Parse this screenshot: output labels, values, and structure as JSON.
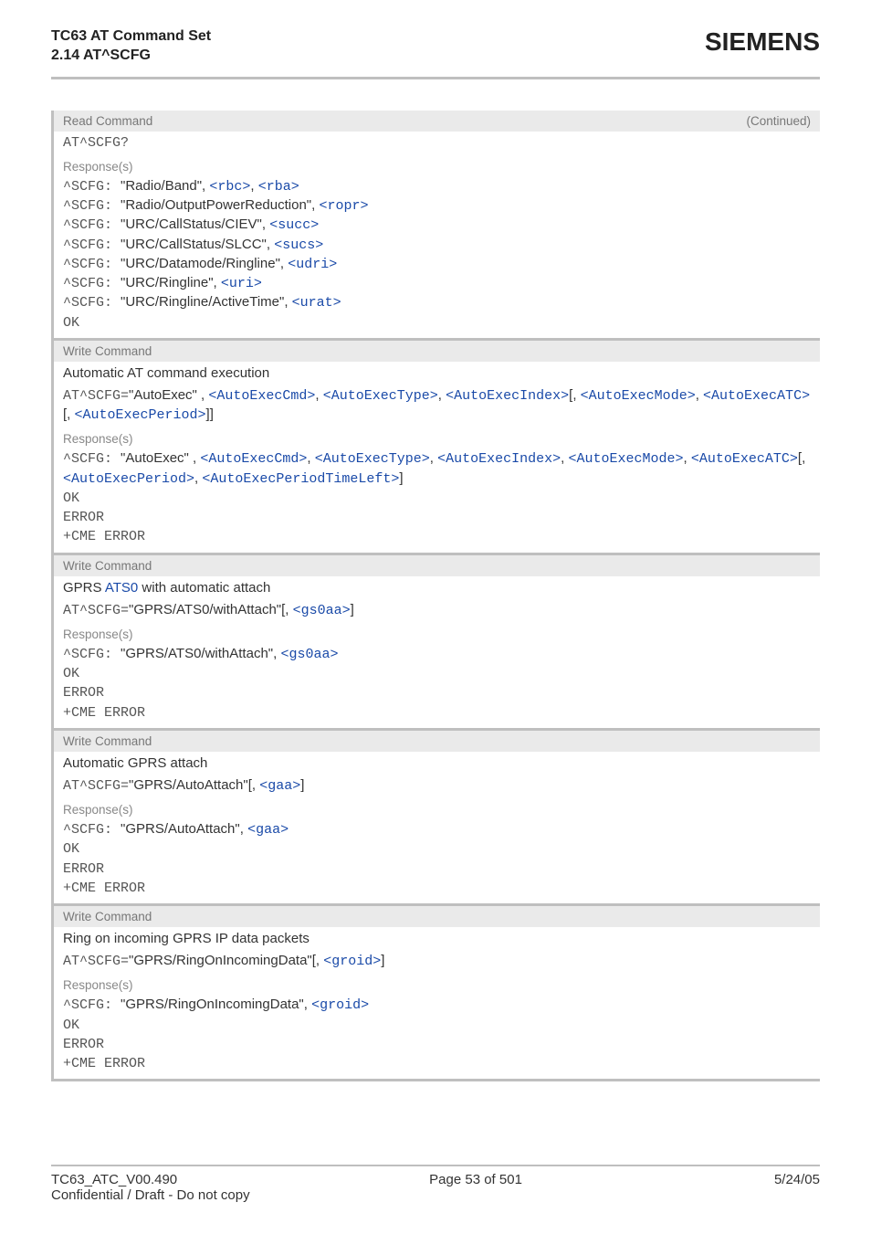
{
  "header": {
    "title_line1": "TC63 AT Command Set",
    "title_line2": "2.14 AT^SCFG",
    "brand": "SIEMENS"
  },
  "sections": [
    {
      "head_left": "Read Command",
      "head_right": "(Continued)",
      "cmd_segments": [
        {
          "cls": "mono",
          "text": "AT^SCFG?"
        }
      ],
      "sub": "Response(s)",
      "lines": [
        [
          {
            "cls": "mono",
            "text": "^SCFG: "
          },
          {
            "cls": "txt",
            "text": "\"Radio/Band\", "
          },
          {
            "cls": "link",
            "text": "<rbc>"
          },
          {
            "cls": "txt",
            "text": ", "
          },
          {
            "cls": "link",
            "text": "<rba>"
          }
        ],
        [
          {
            "cls": "mono",
            "text": "^SCFG: "
          },
          {
            "cls": "txt",
            "text": "\"Radio/OutputPowerReduction\", "
          },
          {
            "cls": "link",
            "text": "<ropr>"
          }
        ],
        [
          {
            "cls": "mono",
            "text": "^SCFG: "
          },
          {
            "cls": "txt",
            "text": "\"URC/CallStatus/CIEV\", "
          },
          {
            "cls": "link",
            "text": "<succ>"
          }
        ],
        [
          {
            "cls": "mono",
            "text": "^SCFG: "
          },
          {
            "cls": "txt",
            "text": "\"URC/CallStatus/SLCC\", "
          },
          {
            "cls": "link",
            "text": "<sucs>"
          }
        ],
        [
          {
            "cls": "mono",
            "text": "^SCFG: "
          },
          {
            "cls": "txt",
            "text": "\"URC/Datamode/Ringline\", "
          },
          {
            "cls": "link",
            "text": "<udri>"
          }
        ],
        [
          {
            "cls": "mono",
            "text": "^SCFG: "
          },
          {
            "cls": "txt",
            "text": "\"URC/Ringline\", "
          },
          {
            "cls": "link",
            "text": "<uri>"
          }
        ],
        [
          {
            "cls": "mono",
            "text": "^SCFG: "
          },
          {
            "cls": "txt",
            "text": "\"URC/Ringline/ActiveTime\", "
          },
          {
            "cls": "link",
            "text": "<urat>"
          }
        ],
        [
          {
            "cls": "mono",
            "text": "OK"
          }
        ]
      ]
    },
    {
      "head_left": "Write Command",
      "desc": "Automatic AT command execution",
      "cmd_segments": [
        {
          "cls": "mono",
          "text": "AT^SCFG="
        },
        {
          "cls": "txt",
          "text": "\"AutoExec\" , "
        },
        {
          "cls": "link",
          "text": "<AutoExecCmd>"
        },
        {
          "cls": "txt",
          "text": ", "
        },
        {
          "cls": "link",
          "text": "<AutoExecType>"
        },
        {
          "cls": "txt",
          "text": ", "
        },
        {
          "cls": "link",
          "text": "<AutoExecIndex>"
        },
        {
          "cls": "txt",
          "text": "[, "
        },
        {
          "cls": "link",
          "text": "<AutoExecMode>"
        },
        {
          "cls": "txt",
          "text": ", "
        },
        {
          "cls": "link",
          "text": "<AutoExecATC>"
        },
        {
          "cls": "txt",
          "text": "[, "
        },
        {
          "cls": "link",
          "text": "<AutoExecPeriod>"
        },
        {
          "cls": "txt",
          "text": "]]"
        }
      ],
      "sub": "Response(s)",
      "lines": [
        [
          {
            "cls": "mono",
            "text": "^SCFG: "
          },
          {
            "cls": "txt",
            "text": "\"AutoExec\" , "
          },
          {
            "cls": "link",
            "text": "<AutoExecCmd>"
          },
          {
            "cls": "txt",
            "text": ", "
          },
          {
            "cls": "link",
            "text": "<AutoExecType>"
          },
          {
            "cls": "txt",
            "text": ", "
          },
          {
            "cls": "link",
            "text": "<AutoExecIndex>"
          },
          {
            "cls": "txt",
            "text": ", "
          },
          {
            "cls": "link",
            "text": "<AutoExecMode>"
          },
          {
            "cls": "txt",
            "text": ", "
          },
          {
            "cls": "link",
            "text": "<AutoExecATC>"
          },
          {
            "cls": "txt",
            "text": "[, "
          },
          {
            "cls": "link",
            "text": "<AutoExecPeriod>"
          },
          {
            "cls": "txt",
            "text": ", "
          },
          {
            "cls": "link",
            "text": "<AutoExecPeriodTimeLeft>"
          },
          {
            "cls": "txt",
            "text": "]"
          }
        ],
        [
          {
            "cls": "mono",
            "text": "OK"
          }
        ],
        [
          {
            "cls": "mono",
            "text": "ERROR"
          }
        ],
        [
          {
            "cls": "mono",
            "text": "+CME ERROR"
          }
        ]
      ]
    },
    {
      "head_left": "Write Command",
      "desc_segments": [
        {
          "cls": "txt",
          "text": "GPRS "
        },
        {
          "cls": "linka",
          "text": "ATS0"
        },
        {
          "cls": "txt",
          "text": " with automatic attach"
        }
      ],
      "cmd_segments": [
        {
          "cls": "mono",
          "text": "AT^SCFG="
        },
        {
          "cls": "txt",
          "text": "\"GPRS/ATS0/withAttach\"[, "
        },
        {
          "cls": "link",
          "text": "<gs0aa>"
        },
        {
          "cls": "txt",
          "text": "]"
        }
      ],
      "sub": "Response(s)",
      "lines": [
        [
          {
            "cls": "mono",
            "text": "^SCFG: "
          },
          {
            "cls": "txt",
            "text": "\"GPRS/ATS0/withAttach\", "
          },
          {
            "cls": "link",
            "text": "<gs0aa>"
          }
        ],
        [
          {
            "cls": "mono",
            "text": "OK"
          }
        ],
        [
          {
            "cls": "mono",
            "text": "ERROR"
          }
        ],
        [
          {
            "cls": "mono",
            "text": "+CME ERROR"
          }
        ]
      ]
    },
    {
      "head_left": "Write Command",
      "desc": "Automatic GPRS attach",
      "cmd_segments": [
        {
          "cls": "mono",
          "text": "AT^SCFG="
        },
        {
          "cls": "txt",
          "text": "\"GPRS/AutoAttach\"[, "
        },
        {
          "cls": "link",
          "text": "<gaa>"
        },
        {
          "cls": "txt",
          "text": "]"
        }
      ],
      "sub": "Response(s)",
      "lines": [
        [
          {
            "cls": "mono",
            "text": "^SCFG: "
          },
          {
            "cls": "txt",
            "text": "\"GPRS/AutoAttach\", "
          },
          {
            "cls": "link",
            "text": "<gaa>"
          }
        ],
        [
          {
            "cls": "mono",
            "text": "OK"
          }
        ],
        [
          {
            "cls": "mono",
            "text": "ERROR"
          }
        ],
        [
          {
            "cls": "mono",
            "text": "+CME ERROR"
          }
        ]
      ]
    },
    {
      "head_left": "Write Command",
      "desc": "Ring on incoming GPRS IP data packets",
      "cmd_segments": [
        {
          "cls": "mono",
          "text": "AT^SCFG="
        },
        {
          "cls": "txt",
          "text": "\"GPRS/RingOnIncomingData\"[, "
        },
        {
          "cls": "link",
          "text": "<groid>"
        },
        {
          "cls": "txt",
          "text": "]"
        }
      ],
      "sub": "Response(s)",
      "lines": [
        [
          {
            "cls": "mono",
            "text": "^SCFG: "
          },
          {
            "cls": "txt",
            "text": "\"GPRS/RingOnIncomingData\", "
          },
          {
            "cls": "link",
            "text": "<groid>"
          }
        ],
        [
          {
            "cls": "mono",
            "text": "OK"
          }
        ],
        [
          {
            "cls": "mono",
            "text": "ERROR"
          }
        ],
        [
          {
            "cls": "mono",
            "text": "+CME ERROR"
          }
        ]
      ]
    }
  ],
  "footer": {
    "left": "TC63_ATC_V00.490",
    "center": "Page 53 of 501",
    "right": "5/24/05",
    "line2": "Confidential / Draft - Do not copy"
  }
}
